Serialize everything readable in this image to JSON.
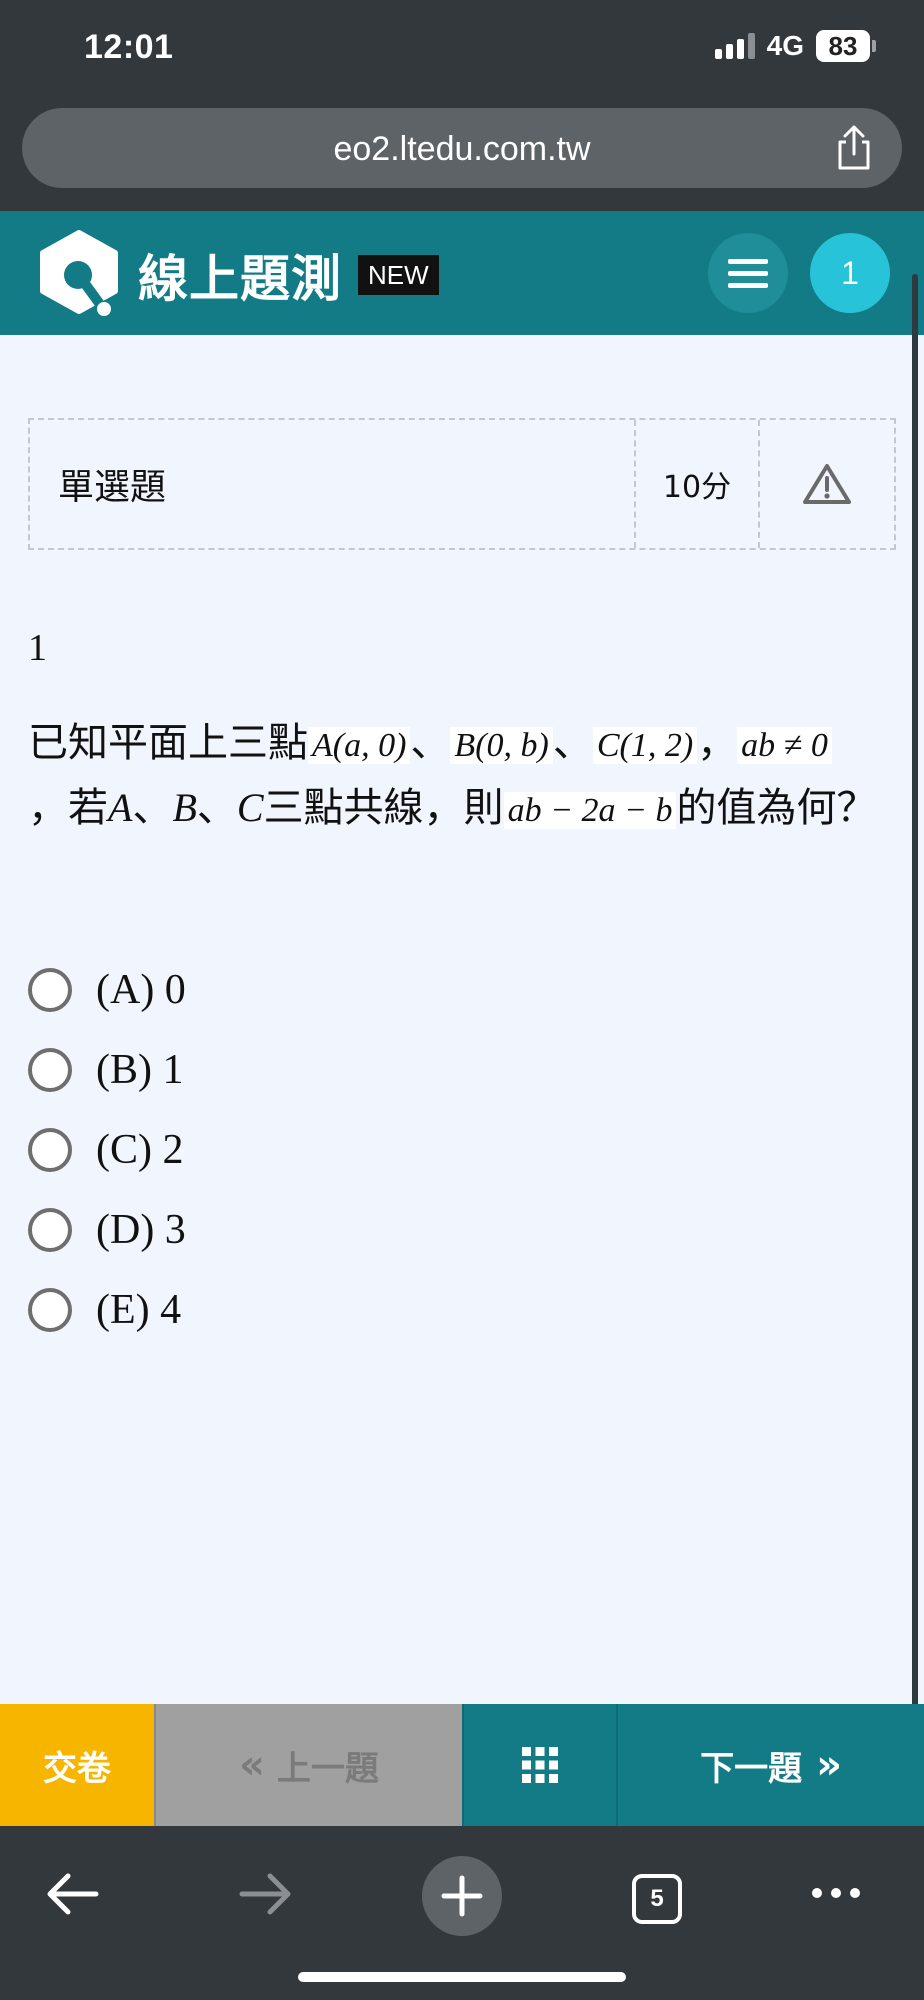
{
  "status_bar": {
    "time": "12:01",
    "network": "4G",
    "battery": "83"
  },
  "browser": {
    "url": "eo2.ltedu.com.tw",
    "tab_count": "5"
  },
  "header": {
    "title": "線上題測",
    "badge": "NEW",
    "current_question": "1",
    "brand_color": "#137b85"
  },
  "question_meta": {
    "type": "單選題",
    "score": "10分"
  },
  "question": {
    "number": "1",
    "text_part1": "已知平面上三點",
    "point_a": "A(a, 0)",
    "sep1": "、",
    "point_b": "B(0, b)",
    "sep2": "、",
    "point_c": "C(1, 2)",
    "comma1": "，",
    "condition": "ab ≠ 0",
    "text_part2": "，若",
    "var_a": "A",
    "sep3": "、",
    "var_b": "B",
    "sep4": "、",
    "var_c": "C",
    "text_part3": "三點共線，則",
    "expression": "ab − 2a − b",
    "text_part4": "的值為何？"
  },
  "options": [
    {
      "label": "(A) 0"
    },
    {
      "label": "(B) 1"
    },
    {
      "label": "(C) 2"
    },
    {
      "label": "(D) 3"
    },
    {
      "label": "(E) 4"
    }
  ],
  "actions": {
    "submit": "交卷",
    "prev": "上一題",
    "next": "下一題",
    "submit_color": "#f7b500"
  }
}
